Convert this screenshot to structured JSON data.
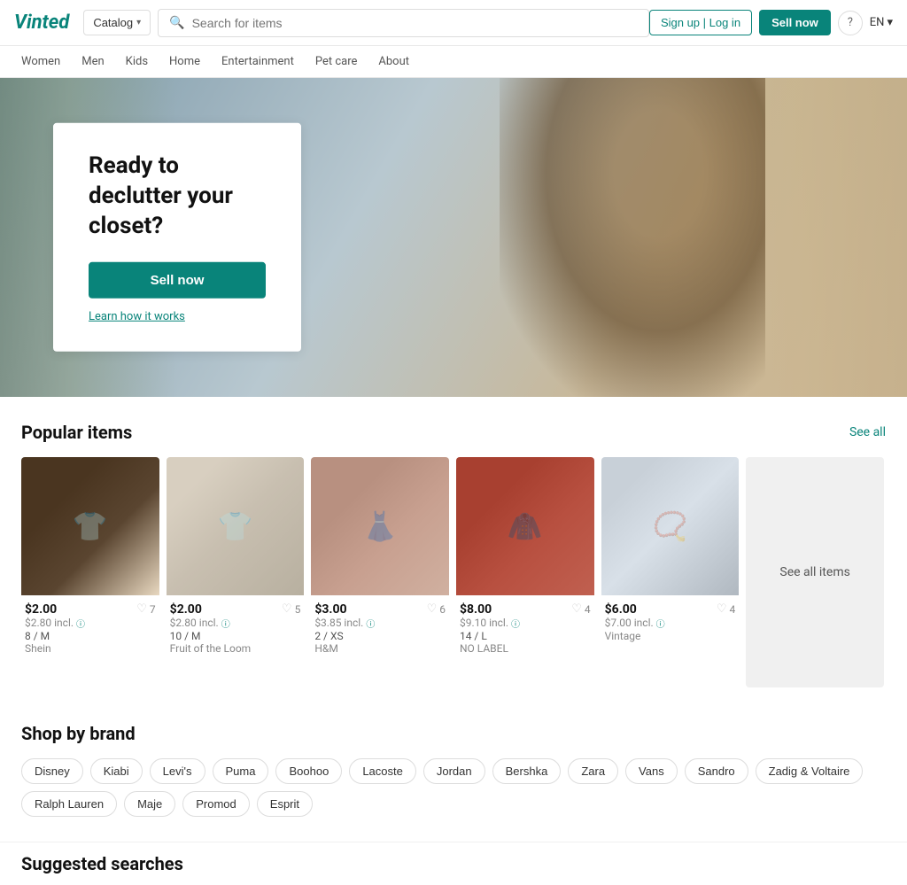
{
  "header": {
    "logo": "Vinted",
    "catalog_label": "Catalog",
    "search_placeholder": "Search for items",
    "signin_label": "Sign up | Log in",
    "sell_now_label": "Sell now",
    "help_icon": "?",
    "lang_label": "EN"
  },
  "nav": {
    "items": [
      {
        "label": "Women"
      },
      {
        "label": "Men"
      },
      {
        "label": "Kids"
      },
      {
        "label": "Home"
      },
      {
        "label": "Entertainment"
      },
      {
        "label": "Pet care"
      },
      {
        "label": "About"
      }
    ]
  },
  "hero": {
    "title": "Ready to declutter your closet?",
    "sell_btn_label": "Sell now",
    "learn_link_label": "Learn how it works"
  },
  "popular_items": {
    "section_title": "Popular items",
    "see_all_label": "See all",
    "see_all_items_label": "See all items",
    "products": [
      {
        "price": "$2.00",
        "price_incl": "$2.80 incl.",
        "likes": 7,
        "size": "8 / M",
        "brand": "Shein",
        "img_class": "img-tshirt1"
      },
      {
        "price": "$2.00",
        "price_incl": "$2.80 incl.",
        "likes": 5,
        "size": "10 / M",
        "brand": "Fruit of the Loom",
        "img_class": "img-tshirt2"
      },
      {
        "price": "$3.00",
        "price_incl": "$3.85 incl.",
        "likes": 6,
        "size": "2 / XS",
        "brand": "H&M",
        "img_class": "img-dress1"
      },
      {
        "price": "$8.00",
        "price_incl": "$9.10 incl.",
        "likes": 4,
        "size": "14 / L",
        "brand": "NO LABEL",
        "img_class": "img-hoodie1"
      },
      {
        "price": "$6.00",
        "price_incl": "$7.00 incl.",
        "likes": 4,
        "size": "",
        "brand": "Vintage",
        "img_class": "img-necklace1"
      }
    ]
  },
  "brands": {
    "section_title": "Shop by brand",
    "items": [
      "Disney",
      "Kiabi",
      "Levi's",
      "Puma",
      "Boohoo",
      "Lacoste",
      "Jordan",
      "Bershka",
      "Zara",
      "Vans",
      "Sandro",
      "Zadig & Voltaire",
      "Ralph Lauren",
      "Maje",
      "Promod",
      "Esprit"
    ]
  },
  "suggested": {
    "section_title": "Suggested searches"
  }
}
